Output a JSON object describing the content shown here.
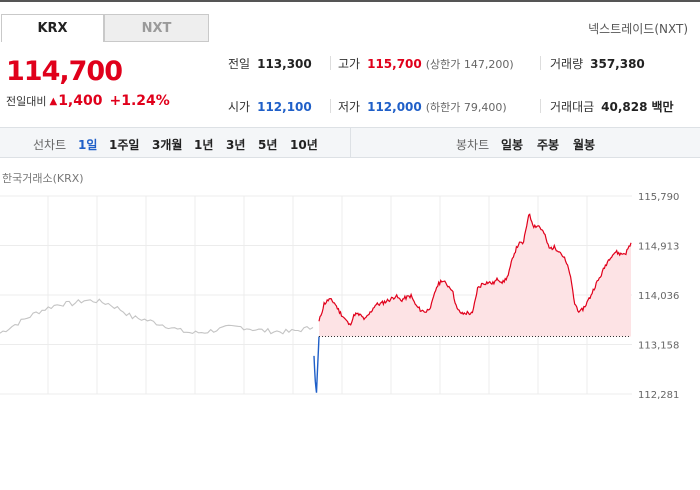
{
  "tabs": {
    "krx": "KRX",
    "nxt": "NXT"
  },
  "nxt_trade": "넥스트레이드(NXT)",
  "quote": {
    "price": "114,700",
    "change_label": "전일대비",
    "change_value": "1,400",
    "change_pct": "+1.24%",
    "direction": "up"
  },
  "stats": {
    "prev_close": {
      "label": "전일",
      "value": "113,300"
    },
    "high": {
      "label": "고가",
      "value": "115,700",
      "sub": "(상한가 147,200)"
    },
    "volume": {
      "label": "거래량",
      "value": "357,380"
    },
    "open": {
      "label": "시가",
      "value": "112,100"
    },
    "low": {
      "label": "저가",
      "value": "112,000",
      "sub": "(하한가 79,400)"
    },
    "amount": {
      "label": "거래대금",
      "value": "40,828",
      "unit": "백만"
    }
  },
  "period_bar": {
    "line_label": "선차트",
    "line_periods": [
      "1일",
      "1주일",
      "3개월",
      "1년",
      "3년",
      "5년",
      "10년"
    ],
    "active_period": "1일",
    "candle_label": "봉차트",
    "candle_periods": [
      "일봉",
      "주봉",
      "월봉"
    ]
  },
  "chart_exchange_label": "한국거래소(KRX)",
  "colors": {
    "up": "#e0001b",
    "down": "#1f5fc8",
    "pre_market": "#c4c4c4"
  },
  "chart_data": {
    "type": "line",
    "title": "",
    "xlabel": "",
    "ylabel": "",
    "y_ticks": [
      "115,790",
      "114,913",
      "114,036",
      "113,158",
      "112,281"
    ],
    "ylim": [
      112281,
      115790
    ],
    "baseline": 113300,
    "grid": true,
    "series": [
      {
        "values": [
          113360,
          113480,
          113600,
          113720,
          113810,
          113880,
          113880,
          113940,
          113930,
          113880,
          113780,
          113640,
          113600,
          113540,
          113480,
          113400,
          113360,
          113380,
          113420,
          113460,
          113470,
          113430,
          113400,
          113390,
          113380,
          113420,
          113460
        ]
      },
      {
        "values": [
          112960,
          112500,
          112300,
          112820,
          113300
        ]
      },
      {
        "values": [
          113560,
          113880,
          113960,
          113900,
          113740,
          113620,
          113500,
          113700,
          113680,
          113600,
          113720,
          113860,
          113880,
          113920,
          113960,
          114020,
          113940,
          113990,
          114020,
          113840,
          113760,
          113740,
          113860,
          114180,
          114300,
          114220,
          114140,
          113780,
          113700,
          113720,
          113700,
          114150,
          114240,
          114260,
          114240,
          114320,
          114260,
          114380,
          114740,
          114940,
          114960,
          115480,
          115260,
          115260,
          115130,
          114860,
          114880,
          114820,
          114680,
          114440,
          113880,
          113720,
          113840,
          114000,
          114200,
          114360,
          114560,
          114720,
          114800,
          114760,
          114780,
          114960
        ]
      }
    ]
  }
}
